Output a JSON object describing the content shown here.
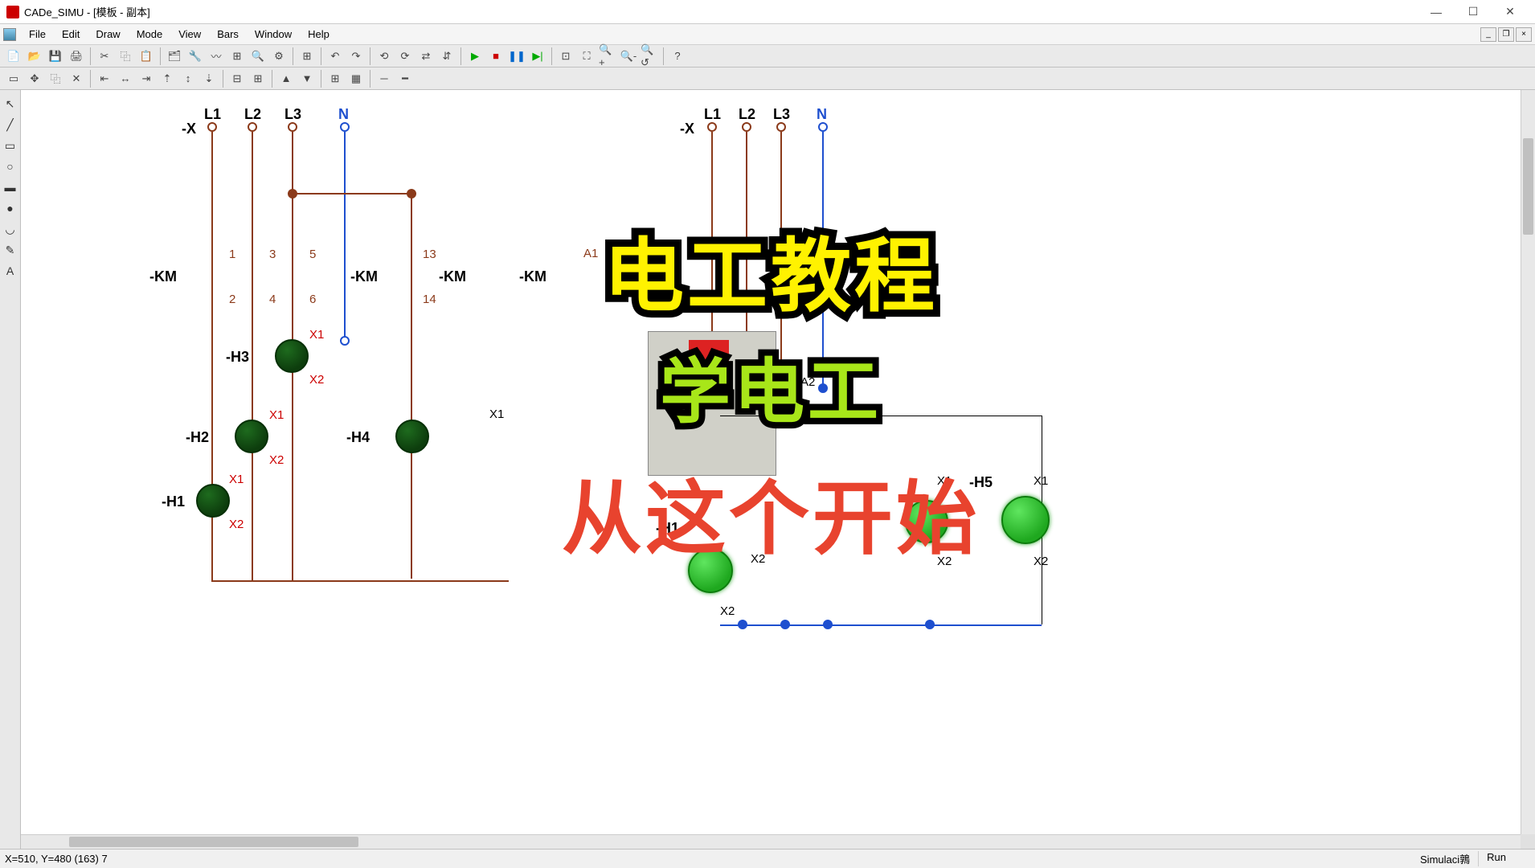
{
  "title": "CADe_SIMU - [模板 - 副本]",
  "menu": {
    "file": "File",
    "edit": "Edit",
    "draw": "Draw",
    "mode": "Mode",
    "view": "View",
    "bars": "Bars",
    "window": "Window",
    "help": "Help"
  },
  "status": {
    "coords": "X=510, Y=480 (163) 7",
    "sim": "Simulaci鶉",
    "run": "Run"
  },
  "overlay": {
    "line1": "电工教程",
    "line2": "学电工",
    "line3": "从这个开始"
  },
  "schematic": {
    "terminals_left": {
      "L1": "L1",
      "L2": "L2",
      "L3": "L3",
      "N": "N",
      "X": "-X"
    },
    "terminals_right": {
      "L1": "L1",
      "L2": "L2",
      "L3": "L3",
      "N": "N",
      "X": "-X"
    },
    "km": "-KM",
    "contacts": {
      "c1": "1",
      "c2": "2",
      "c3": "3",
      "c4": "4",
      "c5": "5",
      "c6": "6",
      "c13": "13",
      "c14": "14"
    },
    "coil": {
      "a1": "A1",
      "a2": "A2"
    },
    "x1": "X1",
    "x2": "X2",
    "lamps": {
      "h1": "-H1",
      "h2": "-H2",
      "h3": "-H3",
      "h4": "-H4",
      "h5": "-H5"
    }
  }
}
